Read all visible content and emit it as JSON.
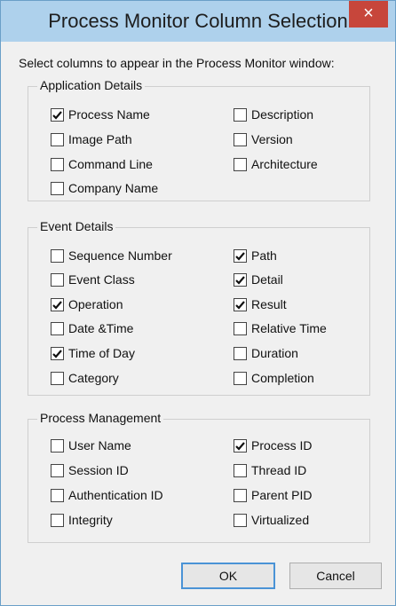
{
  "window": {
    "title": "Process Monitor Column Selection",
    "close_glyph": "×"
  },
  "intro": "Select columns to appear in the Process Monitor window:",
  "groups": [
    {
      "label": "Application Details",
      "items": [
        {
          "label": "Process Name",
          "checked": true
        },
        {
          "label": "Image Path",
          "checked": false
        },
        {
          "label": "Command Line",
          "checked": false
        },
        {
          "label": "Company Name",
          "checked": false
        },
        {
          "label": "Description",
          "checked": false
        },
        {
          "label": "Version",
          "checked": false
        },
        {
          "label": "Architecture",
          "checked": false
        }
      ]
    },
    {
      "label": "Event Details",
      "items": [
        {
          "label": "Sequence Number",
          "checked": false
        },
        {
          "label": "Event Class",
          "checked": false
        },
        {
          "label": "Operation",
          "checked": true
        },
        {
          "label": "Date &Time",
          "checked": false
        },
        {
          "label": "Time of Day",
          "checked": true
        },
        {
          "label": "Category",
          "checked": false
        },
        {
          "label": "Path",
          "checked": true
        },
        {
          "label": "Detail",
          "checked": true
        },
        {
          "label": "Result",
          "checked": true
        },
        {
          "label": "Relative Time",
          "checked": false
        },
        {
          "label": "Duration",
          "checked": false
        },
        {
          "label": "Completion",
          "checked": false
        }
      ]
    },
    {
      "label": "Process Management",
      "items": [
        {
          "label": "User Name",
          "checked": false
        },
        {
          "label": "Session ID",
          "checked": false
        },
        {
          "label": "Authentication ID",
          "checked": false
        },
        {
          "label": "Integrity",
          "checked": false
        },
        {
          "label": "Process ID",
          "checked": true
        },
        {
          "label": "Thread ID",
          "checked": false
        },
        {
          "label": "Parent PID",
          "checked": false
        },
        {
          "label": "Virtualized",
          "checked": false
        }
      ]
    }
  ],
  "buttons": {
    "ok": "OK",
    "cancel": "Cancel"
  }
}
